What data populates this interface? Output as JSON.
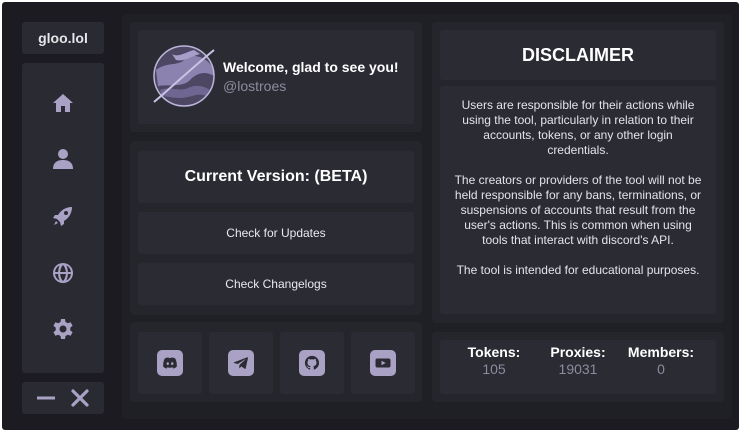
{
  "app": {
    "title": "gloo.lol"
  },
  "sidebar": {
    "items": [
      {
        "name": "home",
        "icon": "home-icon"
      },
      {
        "name": "profile",
        "icon": "user-icon"
      },
      {
        "name": "launch",
        "icon": "rocket-icon"
      },
      {
        "name": "web",
        "icon": "globe-icon"
      },
      {
        "name": "settings",
        "icon": "gear-icon"
      }
    ],
    "controls": {
      "minimize_icon": "minimize-icon",
      "close_icon": "close-icon"
    }
  },
  "profile": {
    "welcome": "Welcome, glad to see you!",
    "username": "@lostroes",
    "avatar_icon": "planet-avatar"
  },
  "version": {
    "title": "Current Version: (BETA)",
    "check_updates": "Check for Updates",
    "check_changelogs": "Check Changelogs"
  },
  "socials": [
    {
      "name": "discord",
      "icon": "discord-icon"
    },
    {
      "name": "telegram",
      "icon": "telegram-icon"
    },
    {
      "name": "github",
      "icon": "github-icon"
    },
    {
      "name": "youtube",
      "icon": "youtube-icon"
    }
  ],
  "disclaimer": {
    "title": "DISCLAIMER",
    "paragraphs": [
      "Users are responsible for their actions while using the tool, particularly in relation to their accounts, tokens, or any other login credentials.",
      "The creators or providers of the tool will not be held responsible for any bans, terminations, or suspensions of accounts that result from the user's actions. This is common when using tools that interact with discord's API.",
      "The tool is intended for educational purposes."
    ]
  },
  "stats": {
    "tokens": {
      "label": "Tokens:",
      "value": "105"
    },
    "proxies": {
      "label": "Proxies:",
      "value": "19031"
    },
    "members": {
      "label": "Members:",
      "value": "0"
    }
  },
  "colors": {
    "background": "#1b1b21",
    "panel": "#25252c",
    "card": "#2b2b33",
    "accent": "#a9a2c5",
    "muted_text": "#8e8a9e"
  }
}
